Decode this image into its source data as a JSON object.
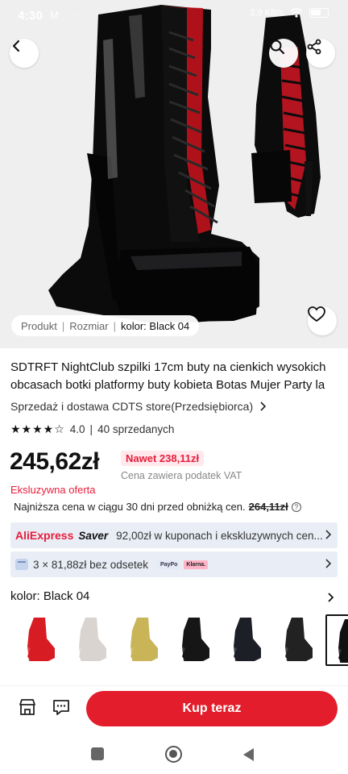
{
  "status_bar": {
    "time": "4:30",
    "message_icon": "M",
    "dot": "·",
    "right_text": "2,9 KB/s",
    "wifi": "wifi-icon",
    "battery": "battery-icon"
  },
  "gallery": {
    "chips": [
      "Produkt",
      "Rozmiar",
      "kolor: Black 04"
    ],
    "active_chip_index": 2
  },
  "product": {
    "title_line1": "SDTRFT NightClub szpilki 17cm buty na cienkich wysokich",
    "title_line2": "obcasach botki platformy buty kobieta Botas Mujer Party la",
    "store": "Sprzedaż i dostawa CDTS store(Przedsiębiorca)",
    "rating_value": "4.0",
    "rating_stars": 4,
    "sold": "40 sprzedanych",
    "price": "245,62zł",
    "promo_price": "Nawet 238,11zł",
    "vat_note": "Cena zawiera podatek VAT",
    "exclusive_label": "Eksluzywna oferta",
    "lowest_price_label": "Najniższa cena w ciągu 30 dni przed obniżką cen.",
    "lowest_price_value": "264,11zł"
  },
  "saver_bar": {
    "brand": "AliExpress",
    "saver": "Saver",
    "text": "92,00zł w kuponach i ekskluzywnych cen..."
  },
  "installments": {
    "text": "3 × 81,88zł bez odsetek",
    "badge1": "PayPo",
    "badge2": "Klarna."
  },
  "variant": {
    "label": "kolor: Black 04",
    "thumbnails": [
      {
        "name": "red",
        "color": "#d81c24"
      },
      {
        "name": "clear",
        "color": "#d9d4cf"
      },
      {
        "name": "gold-glitter",
        "color": "#c9b458"
      },
      {
        "name": "black-buckles",
        "color": "#161616"
      },
      {
        "name": "black-matte",
        "color": "#1d1f27"
      },
      {
        "name": "black-clear-heel",
        "color": "#222222"
      },
      {
        "name": "black-red",
        "color": "#111111"
      },
      {
        "name": "partial",
        "color": "#b01c2a"
      }
    ],
    "selected_index": 6
  },
  "actions": {
    "buy_label": "Kup teraz"
  },
  "colors": {
    "accent": "#e31d2b",
    "promo_bg": "#ffe9ec",
    "bar_bg": "#e8edf6"
  }
}
